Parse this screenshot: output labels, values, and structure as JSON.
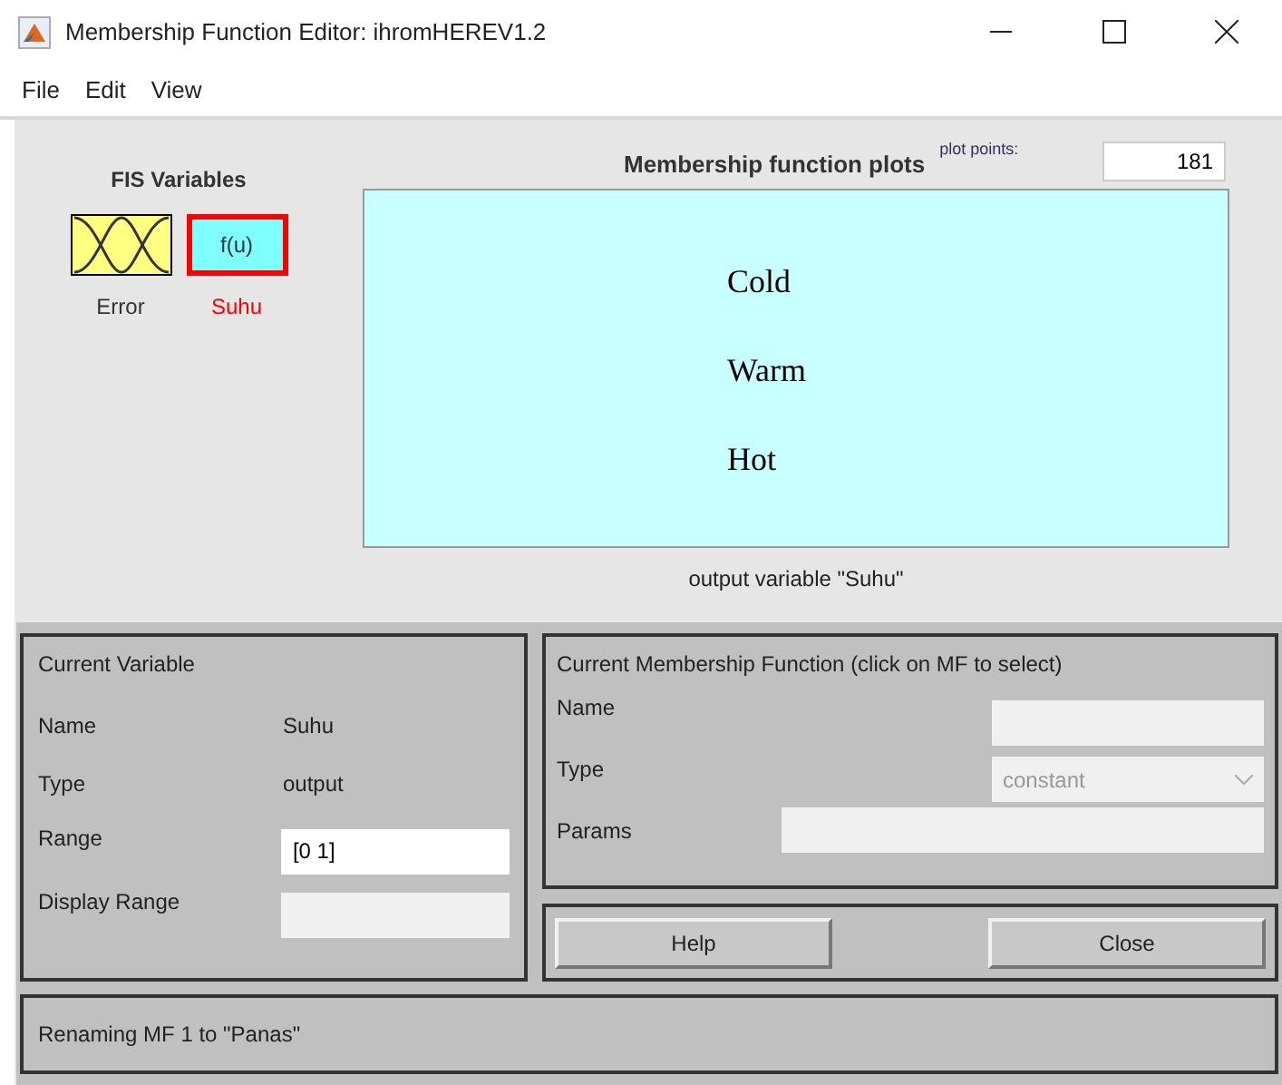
{
  "window": {
    "title": "Membership Function Editor: ihromHEREV1.2"
  },
  "menu": [
    "File",
    "Edit",
    "View"
  ],
  "fis_variables": {
    "title": "FIS Variables",
    "items": [
      {
        "kind": "input",
        "label": "Error",
        "selected": false
      },
      {
        "kind": "output",
        "label": "Suhu",
        "icon_text": "f(u)",
        "selected": true
      }
    ]
  },
  "plot": {
    "title": "Membership function plots",
    "plot_points_label": "plot points:",
    "plot_points": "181",
    "mf_labels": [
      "Cold",
      "Warm",
      "Hot"
    ],
    "caption": "output variable \"Suhu\""
  },
  "current_variable": {
    "title": "Current Variable",
    "name_label": "Name",
    "name": "Suhu",
    "type_label": "Type",
    "type": "output",
    "range_label": "Range",
    "range": "[0 1]",
    "display_range_label": "Display Range"
  },
  "current_mf": {
    "title": "Current Membership Function (click on MF to select)",
    "name_label": "Name",
    "type_label": "Type",
    "type": "constant",
    "params_label": "Params",
    "disabled": true
  },
  "buttons": [
    "Help",
    "Close"
  ],
  "status": "Renaming MF 1 to \"Panas\""
}
